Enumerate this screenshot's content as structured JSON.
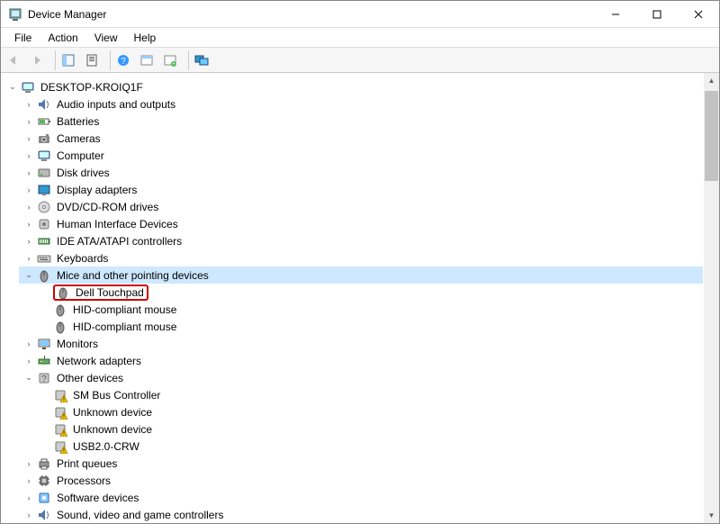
{
  "titlebar": {
    "title": "Device Manager"
  },
  "menu": {
    "file": "File",
    "action": "Action",
    "view": "View",
    "help": "Help"
  },
  "tree": {
    "root": "DESKTOP-KROIQ1F",
    "categories": [
      {
        "label": "Audio inputs and outputs",
        "icon": "audio",
        "expanded": false
      },
      {
        "label": "Batteries",
        "icon": "battery",
        "expanded": false
      },
      {
        "label": "Cameras",
        "icon": "camera",
        "expanded": false
      },
      {
        "label": "Computer",
        "icon": "computer",
        "expanded": false
      },
      {
        "label": "Disk drives",
        "icon": "disk",
        "expanded": false
      },
      {
        "label": "Display adapters",
        "icon": "display",
        "expanded": false
      },
      {
        "label": "DVD/CD-ROM drives",
        "icon": "dvd",
        "expanded": false
      },
      {
        "label": "Human Interface Devices",
        "icon": "hid",
        "expanded": false
      },
      {
        "label": "IDE ATA/ATAPI controllers",
        "icon": "ide",
        "expanded": false
      },
      {
        "label": "Keyboards",
        "icon": "keyboard",
        "expanded": false
      },
      {
        "label": "Mice and other pointing devices",
        "icon": "mouse",
        "expanded": true,
        "selected": true,
        "children": [
          {
            "label": "Dell Touchpad",
            "icon": "mouse",
            "highlighted": true
          },
          {
            "label": "HID-compliant mouse",
            "icon": "mouse"
          },
          {
            "label": "HID-compliant mouse",
            "icon": "mouse"
          }
        ]
      },
      {
        "label": "Monitors",
        "icon": "monitor",
        "expanded": false
      },
      {
        "label": "Network adapters",
        "icon": "network",
        "expanded": false
      },
      {
        "label": "Other devices",
        "icon": "other",
        "expanded": true,
        "children": [
          {
            "label": "SM Bus Controller",
            "icon": "warn"
          },
          {
            "label": "Unknown device",
            "icon": "warn"
          },
          {
            "label": "Unknown device",
            "icon": "warn"
          },
          {
            "label": "USB2.0-CRW",
            "icon": "warn"
          }
        ]
      },
      {
        "label": "Print queues",
        "icon": "printer",
        "expanded": false
      },
      {
        "label": "Processors",
        "icon": "processor",
        "expanded": false
      },
      {
        "label": "Software devices",
        "icon": "software",
        "expanded": false
      },
      {
        "label": "Sound, video and game controllers",
        "icon": "sound",
        "expanded": false,
        "cut": true
      }
    ]
  }
}
